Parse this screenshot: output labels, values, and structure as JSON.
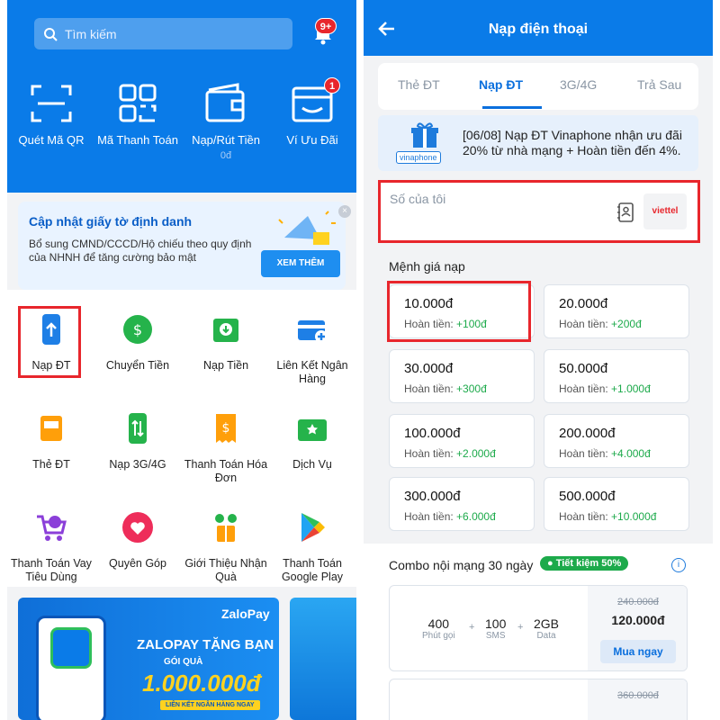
{
  "left": {
    "search_placeholder": "Tìm kiếm",
    "notification_badge": "9+",
    "quick": [
      {
        "label": "Quét Mã QR",
        "icon": "scan-qr-icon"
      },
      {
        "label": "Mã Thanh Toán",
        "icon": "payment-code-icon"
      },
      {
        "label": "Nạp/Rút Tiền",
        "sub": "0đ",
        "icon": "wallet-icon"
      },
      {
        "label": "Ví Ưu Đãi",
        "badge": "1",
        "icon": "voucher-wallet-icon"
      }
    ],
    "promo": {
      "title": "Cập nhật giấy tờ định danh",
      "text": "Bổ sung CMND/CCCD/Hộ chiếu theo quy định của NHNH để tăng cường bảo mật",
      "button": "XEM THÊM",
      "close": "×"
    },
    "services": [
      {
        "label": "Nạp ĐT",
        "icon": "phone-topup-icon"
      },
      {
        "label": "Chuyển Tiền",
        "icon": "transfer-icon"
      },
      {
        "label": "Nạp Tiền",
        "icon": "deposit-icon"
      },
      {
        "label": "Liên Kết Ngân Hàng",
        "icon": "bank-link-icon"
      },
      {
        "label": "Thẻ ĐT",
        "icon": "phone-card-icon"
      },
      {
        "label": "Nạp 3G/4G",
        "icon": "data-topup-icon"
      },
      {
        "label": "Thanh Toán Hóa Đơn",
        "icon": "bill-icon"
      },
      {
        "label": "Dịch Vụ",
        "icon": "services-icon"
      },
      {
        "label": "Thanh Toán Vay Tiêu Dùng",
        "icon": "loan-icon"
      },
      {
        "label": "Quyên Góp",
        "icon": "donate-icon"
      },
      {
        "label": "Giới Thiệu Nhận Quà",
        "icon": "referral-icon"
      },
      {
        "label": "Thanh Toán Google Play",
        "icon": "google-play-icon"
      }
    ],
    "banner": {
      "logo": "ZaloPay",
      "title": "ZALOPAY TẶNG BẠN",
      "sub": "GÓI QUÀ",
      "amount": "1.000.000đ",
      "cta": "LIÊN KẾT NGÂN HÀNG NGAY"
    }
  },
  "right": {
    "title": "Nạp điện thoại",
    "tabs": [
      "Thẻ ĐT",
      "Nạp ĐT",
      "3G/4G",
      "Trả Sau"
    ],
    "active_tab": 1,
    "promo_text": "[06/08] Nạp ĐT Vinaphone nhận ưu đãi 20% từ nhà mạng + Hoàn tiền đến 4%.",
    "promo_brand": "vinaphone",
    "phone_placeholder": "Số của tôi",
    "carrier": "viettel",
    "denom_title": "Mệnh giá nạp",
    "cashback_label": "Hoàn tiền:",
    "denoms": [
      {
        "amount": "10.000đ",
        "cashback": "+100đ"
      },
      {
        "amount": "20.000đ",
        "cashback": "+200đ"
      },
      {
        "amount": "30.000đ",
        "cashback": "+300đ"
      },
      {
        "amount": "50.000đ",
        "cashback": "+1.000đ"
      },
      {
        "amount": "100.000đ",
        "cashback": "+2.000đ"
      },
      {
        "amount": "200.000đ",
        "cashback": "+4.000đ"
      },
      {
        "amount": "300.000đ",
        "cashback": "+6.000đ"
      },
      {
        "amount": "500.000đ",
        "cashback": "+10.000đ"
      }
    ],
    "combo": {
      "title": "Combo nội mạng 30 ngày",
      "badge": "Tiết kiệm 50%",
      "info": "i",
      "minutes": "400",
      "minutes_unit": "Phút gọi",
      "sms": "100",
      "sms_unit": "SMS",
      "data": "2GB",
      "data_unit": "Data",
      "plus": "+",
      "old_price": "240.000đ",
      "new_price": "120.000đ",
      "buy": "Mua ngay",
      "old_price_2": "360.000đ"
    }
  },
  "colors": {
    "brand": "#0a7be8",
    "highlight": "#e8262c",
    "cashback": "#1daa4b"
  }
}
